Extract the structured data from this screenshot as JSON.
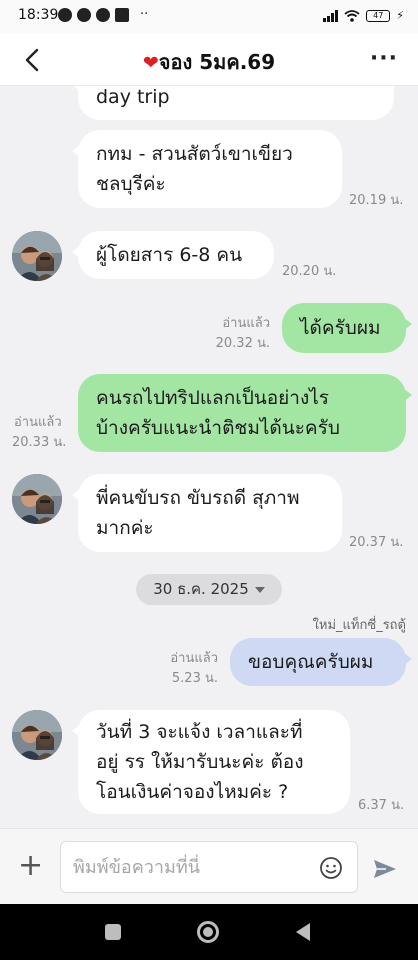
{
  "status_bar": {
    "time": "18:39",
    "battery": "47",
    "left_icons": [
      "alarm-icon",
      "app-icon",
      "chat-icon",
      "grid-icon"
    ],
    "more_indicator": "··"
  },
  "header": {
    "title": "จอง 5มค.69",
    "heart": "❤",
    "back_icon": "chevron-left-icon",
    "more_label": "···"
  },
  "messages": [
    {
      "type": "incoming",
      "text": "day trip"
    },
    {
      "type": "incoming",
      "lines": [
        "กทม - สวนสัตว์เขาเขียว",
        "ชลบุรีค่ะ"
      ],
      "time": "20.19 น."
    },
    {
      "type": "incoming",
      "lines": [
        "ผู้โดยสาร 6-8 คน"
      ],
      "time": "20.20 น."
    },
    {
      "type": "outgoing",
      "lines": [
        "ได้ครับผม"
      ],
      "read": "อ่านแล้ว",
      "time": "20.32 น."
    },
    {
      "type": "outgoing",
      "lines": [
        "คนรถไปทริปแลกเป็นอย่างไร",
        "บ้างครับแนะนำติชมได้นะครับ"
      ],
      "read": "อ่านแล้ว",
      "time": "20.33 น."
    },
    {
      "type": "incoming",
      "lines": [
        "พี่คนขับรถ ขับรถดี สุภาพ",
        "มากค่ะ"
      ],
      "time": "20.37 น."
    },
    {
      "type": "outgoing",
      "lines": [
        "ขอบคุณครับผม"
      ],
      "read": "อ่านแล้ว",
      "time": "5.23 น."
    },
    {
      "type": "incoming",
      "lines": [
        "วันที่ 3 จะแจ้ง เวลาและที่",
        "อยู่ รร ให้มารับนะค่ะ  ต้อง",
        "โอนเงินค่าจองไหมค่ะ ?"
      ],
      "time": "6.37 น."
    }
  ],
  "date_separator": "30 ธ.ค. 2025",
  "sender_name": "ใหม่_แท็กซี่_รถตู้",
  "input": {
    "placeholder": "พิมพ์ข้อความที่นี่",
    "value": ""
  },
  "colors": {
    "incoming_bubble": "#ffffff",
    "outgoing_green": "#a3e6a4",
    "outgoing_blue": "#cfd9f4",
    "chat_background": "#f1f1f4",
    "heart": "#dd2222"
  }
}
